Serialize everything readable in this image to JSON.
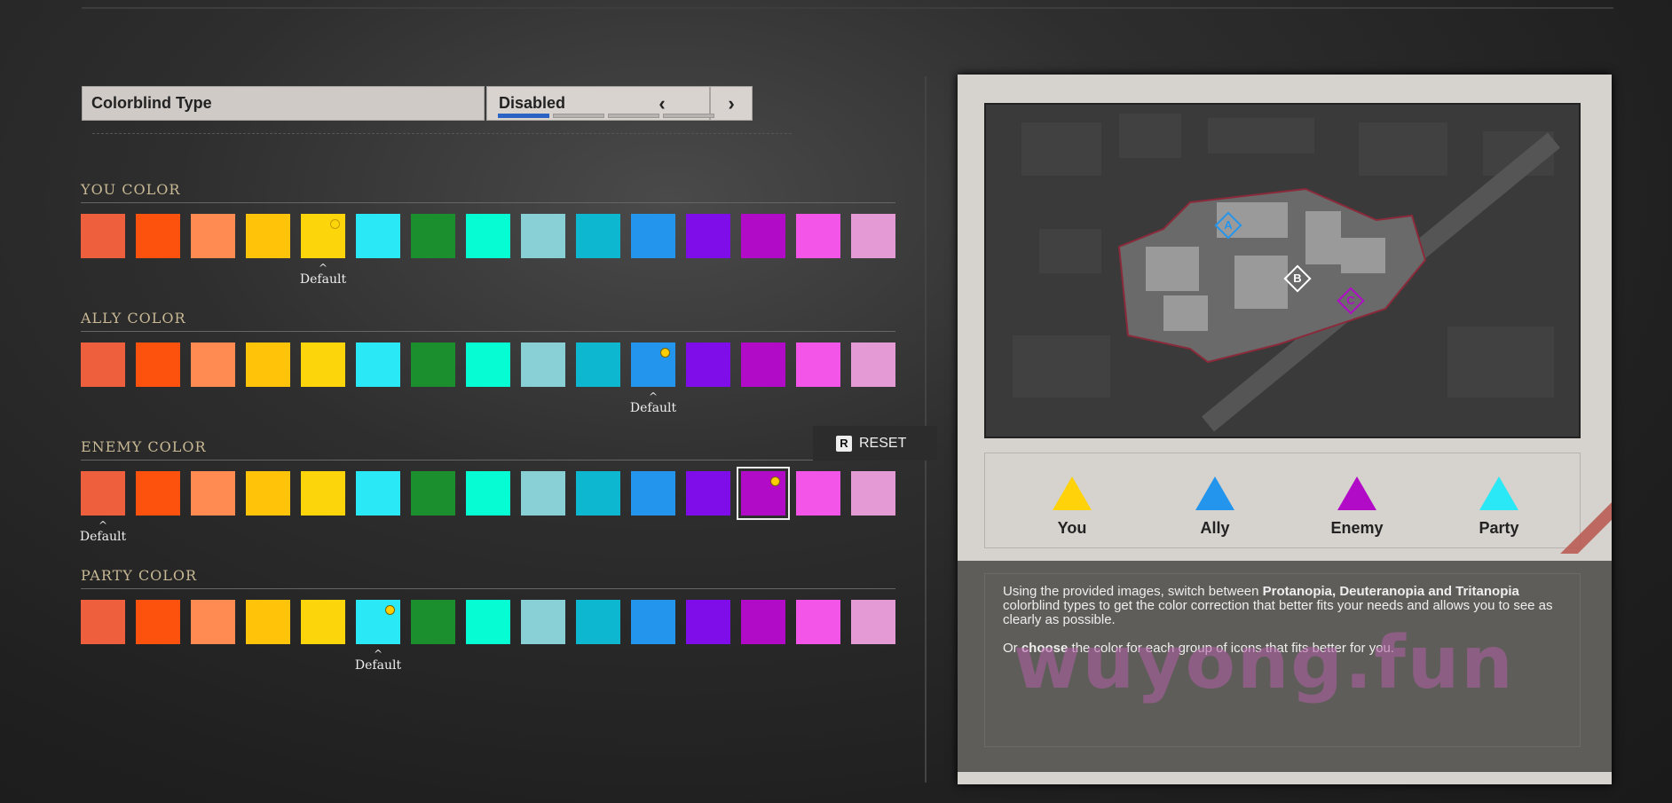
{
  "colorblind": {
    "label": "Colorblind Type",
    "value": "Disabled",
    "prev_glyph": "‹",
    "next_glyph": "›",
    "options_count": 4,
    "selected_index": 0
  },
  "palette": [
    "#ee5f3d",
    "#fd520e",
    "#ff8a52",
    "#ffc40a",
    "#fcd60a",
    "#2ae8f5",
    "#1b8e2d",
    "#06fcd3",
    "#88d0d6",
    "#0cb7cf",
    "#2495ec",
    "#7f0de9",
    "#b10bc7",
    "#f255e7",
    "#e49ad5"
  ],
  "sections": [
    {
      "title": "YOU COLOR",
      "selected": 4,
      "default": 4,
      "default_label": "Default",
      "dot_style": "hollow"
    },
    {
      "title": "ALLY COLOR",
      "selected": 10,
      "default": 10,
      "default_label": "Default",
      "dot_style": "filled"
    },
    {
      "title": "ENEMY COLOR",
      "selected": 12,
      "default": 0,
      "default_label": "Default",
      "dot_style": "filled"
    },
    {
      "title": "PARTY COLOR",
      "selected": 5,
      "default": 5,
      "default_label": "Default",
      "dot_style": "filled"
    }
  ],
  "reset": {
    "key": "R",
    "label": "RESET"
  },
  "legend": [
    {
      "label": "You",
      "color": "#ffd20a"
    },
    {
      "label": "Ally",
      "color": "#2495ec"
    },
    {
      "label": "Enemy",
      "color": "#b10bc7"
    },
    {
      "label": "Party",
      "color": "#2ae8f5"
    }
  ],
  "map_markers": [
    "A",
    "B",
    "C"
  ],
  "description": {
    "p1_before": "Using the provided images, switch between ",
    "p1_bold": "Protanopia, Deuteranopia and Tritanopia",
    "p1_after": " colorblind types to get the color correction that better fits your needs and allows you to see as clearly as possible.",
    "p2_before": "Or ",
    "p2_bold": "choose",
    "p2_after": " the color for each group of icons that fits better for you."
  },
  "watermark": "wuyong.fun"
}
